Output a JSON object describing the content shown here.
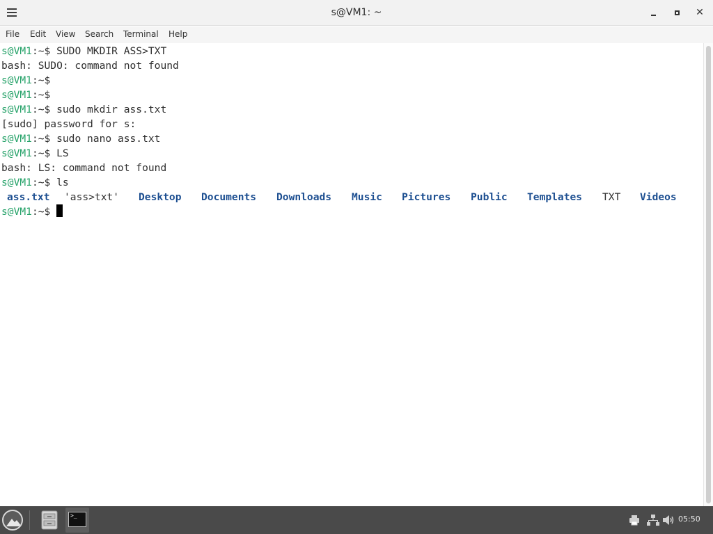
{
  "window": {
    "title": "s@VM1: ~",
    "close_glyph": "✕"
  },
  "menu": [
    {
      "label": "File"
    },
    {
      "label": "Edit"
    },
    {
      "label": "View"
    },
    {
      "label": "Search"
    },
    {
      "label": "Terminal"
    },
    {
      "label": "Help"
    }
  ],
  "terminal": {
    "prompt_user": "s@VM1",
    "prompt_sep": ":~$",
    "lines": [
      {
        "prompt": true,
        "text": " SUDO MKDIR ASS>TXT"
      },
      {
        "prompt": false,
        "text": "bash: SUDO: command not found"
      },
      {
        "prompt": true,
        "text": ""
      },
      {
        "prompt": true,
        "text": ""
      },
      {
        "prompt": true,
        "text": " sudo mkdir ass.txt"
      },
      {
        "prompt": false,
        "text": "[sudo] password for s:"
      },
      {
        "prompt": true,
        "text": " sudo nano ass.txt"
      },
      {
        "prompt": true,
        "text": " LS"
      },
      {
        "prompt": false,
        "text": "bash: LS: command not found"
      },
      {
        "prompt": true,
        "text": " ls"
      }
    ],
    "ls_output": [
      {
        "name": "ass.txt",
        "type": "dir"
      },
      {
        "name": "'ass>txt'",
        "type": "file"
      },
      {
        "name": "Desktop",
        "type": "dir"
      },
      {
        "name": "Documents",
        "type": "dir"
      },
      {
        "name": "Downloads",
        "type": "dir"
      },
      {
        "name": "Music",
        "type": "dir"
      },
      {
        "name": "Pictures",
        "type": "dir"
      },
      {
        "name": "Public",
        "type": "dir"
      },
      {
        "name": "Templates",
        "type": "dir"
      },
      {
        "name": "TXT",
        "type": "file"
      },
      {
        "name": "Videos",
        "type": "dir"
      }
    ]
  },
  "taskbar": {
    "start_icon": "zorin-logo-icon",
    "apps": [
      {
        "icon": "file-manager-icon"
      },
      {
        "icon": "terminal-icon",
        "glyph": ">_",
        "active": true
      }
    ],
    "tray": [
      {
        "icon": "printer-icon"
      },
      {
        "icon": "network-icon"
      },
      {
        "icon": "volume-icon"
      }
    ],
    "clock": "05:50"
  }
}
